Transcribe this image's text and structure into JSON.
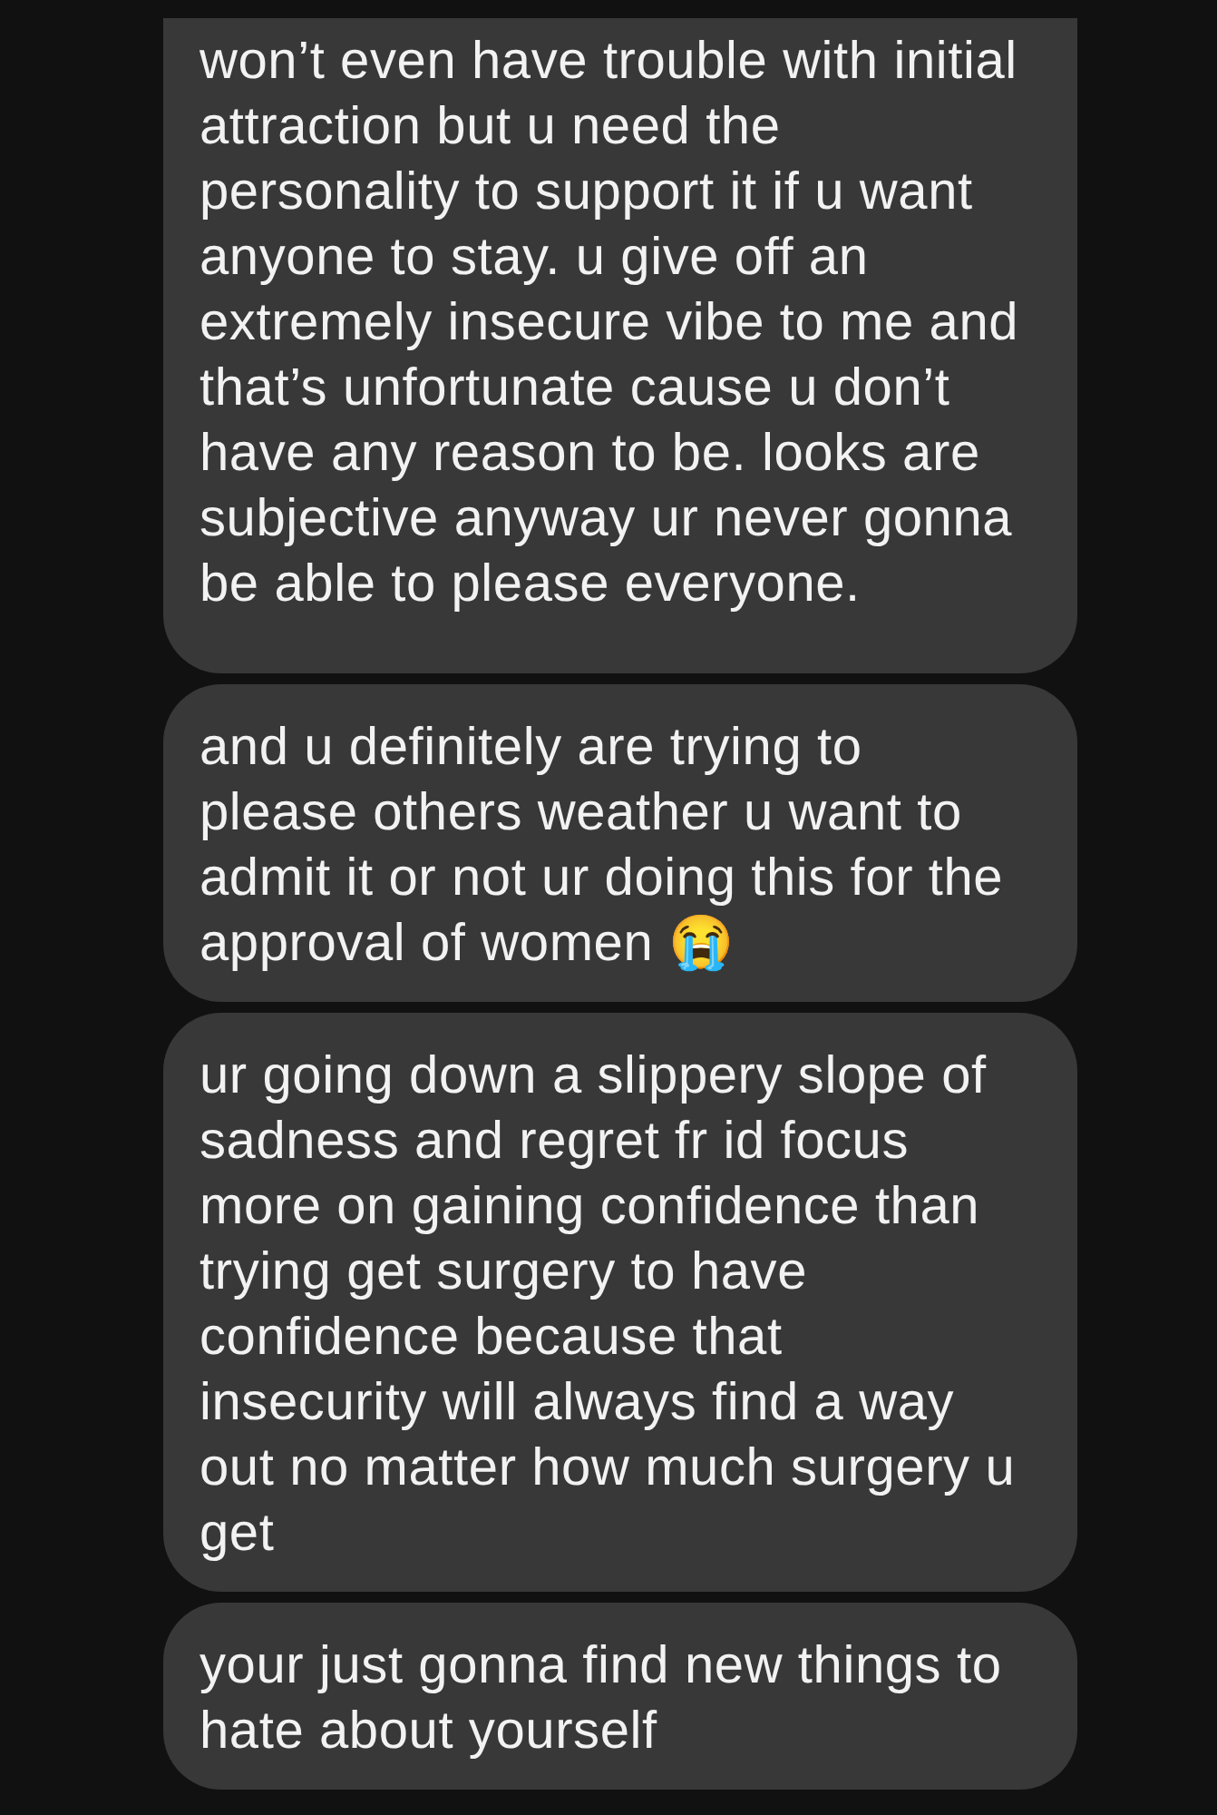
{
  "messages": [
    {
      "text": "won’t even have trouble with initial attraction but u need the personality to support it if u want anyone to stay. u give off an extremely insecure vibe to me and that’s unfortunate cause u don’t have any reason to be. looks are subjective anyway ur never gonna be able to please everyone."
    },
    {
      "text": "and u definitely are trying to please others weather u want to admit it or not ur doing this for the approval of women 😭"
    },
    {
      "text": "ur going down a slippery slope of sadness and regret fr id focus more on gaining confidence than trying get surgery to have confidence because that insecurity will always find a way out no matter how much surgery u get"
    },
    {
      "text": "your just gonna find new things to hate about yourself"
    }
  ]
}
